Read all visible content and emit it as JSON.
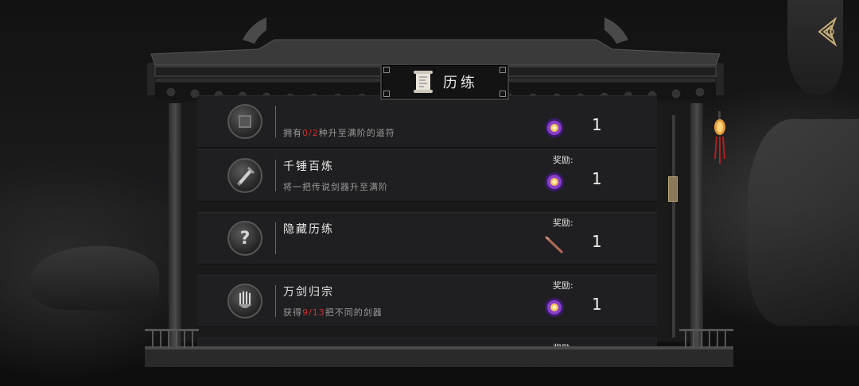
{
  "header": {
    "title": "历练"
  },
  "achievements": [
    {
      "name": "",
      "desc_parts": [
        "拥有",
        "0/2",
        "种升至满阶的道符"
      ],
      "reward_label": "",
      "reward_icon": "spirit-orb-icon",
      "reward_count": "1",
      "badge_icon": "book-icon"
    },
    {
      "name": "千锤百炼",
      "desc_parts": [
        "将一把传说剑器升至满阶",
        "",
        ""
      ],
      "reward_label": "奖励:",
      "reward_icon": "spirit-orb-icon",
      "reward_count": "1",
      "badge_icon": "sword-forge-icon"
    },
    {
      "name": "隐藏历练",
      "desc_parts": [
        "",
        "",
        ""
      ],
      "reward_label": "奖励:",
      "reward_icon": "sword-fragment-icon",
      "reward_count": "1",
      "badge_icon": "question-icon"
    },
    {
      "name": "万剑归宗",
      "desc_parts": [
        "获得",
        "9/13",
        "把不同的剑器"
      ],
      "reward_label": "奖励:",
      "reward_icon": "spirit-orb-icon",
      "reward_count": "1",
      "badge_icon": "sword-hand-icon"
    },
    {
      "name": "",
      "desc_parts": [
        "",
        "",
        ""
      ],
      "reward_label": "奖励:",
      "reward_icon": "",
      "reward_count": "",
      "badge_icon": ""
    }
  ],
  "colors": {
    "highlight": "#d0312d",
    "scroll_thumb": "#8a7a5a"
  },
  "icons": {
    "back": "back-arrow-icon",
    "title": "scroll-icon",
    "lantern": "lantern-icon"
  }
}
